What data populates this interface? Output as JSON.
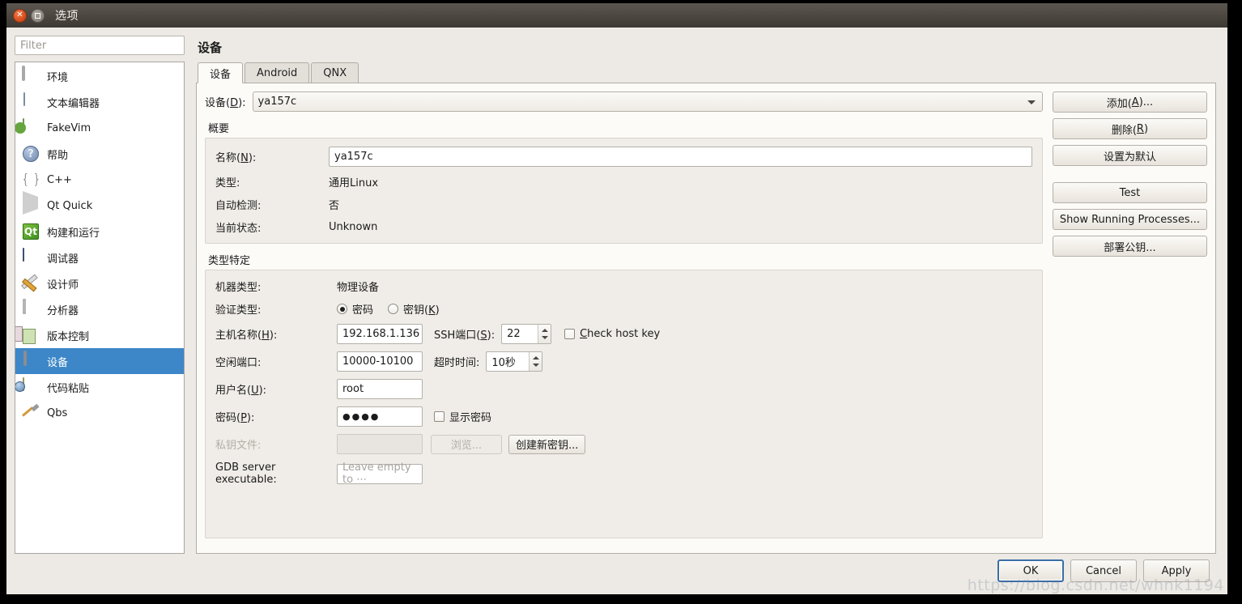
{
  "window": {
    "title": "选项",
    "close_icon": "close-icon",
    "maximize_icon": "maximize-icon"
  },
  "sidebar": {
    "filter_placeholder": "Filter",
    "items": [
      {
        "label": "环境",
        "icon": "monitor-icon",
        "selected": false
      },
      {
        "label": "文本编辑器",
        "icon": "text-editor-icon",
        "selected": false
      },
      {
        "label": "FakeVim",
        "icon": "fakevim-icon",
        "selected": false
      },
      {
        "label": "帮助",
        "icon": "help-icon",
        "selected": false
      },
      {
        "label": "C++",
        "icon": "braces-icon",
        "selected": false
      },
      {
        "label": "Qt Quick",
        "icon": "qtquick-icon",
        "selected": false
      },
      {
        "label": "构建和运行",
        "icon": "build-run-icon",
        "selected": false
      },
      {
        "label": "调试器",
        "icon": "debugger-bug-icon",
        "selected": false
      },
      {
        "label": "设计师",
        "icon": "designer-icon",
        "selected": false
      },
      {
        "label": "分析器",
        "icon": "analyzer-icon",
        "selected": false
      },
      {
        "label": "版本控制",
        "icon": "version-control-icon",
        "selected": false
      },
      {
        "label": "设备",
        "icon": "device-icon",
        "selected": true
      },
      {
        "label": "代码粘贴",
        "icon": "code-paste-icon",
        "selected": false
      },
      {
        "label": "Qbs",
        "icon": "qbs-hammer-icon",
        "selected": false
      }
    ],
    "selected_color": "#3d87c8"
  },
  "page": {
    "title": "设备",
    "tabs": [
      {
        "label": "设备",
        "active": true
      },
      {
        "label": "Android",
        "active": false
      },
      {
        "label": "QNX",
        "active": false
      }
    ]
  },
  "device_select": {
    "label_pre": "设备(",
    "label_mnemonic": "D",
    "label_post": "):",
    "value": "ya157c",
    "arrow_icon": "chevron-down-icon"
  },
  "summary": {
    "title": "概要",
    "name_label_pre": "名称(",
    "name_label_mnemonic": "N",
    "name_label_post": "):",
    "name_value": "ya157c",
    "rows": [
      {
        "label": "类型:",
        "value": "通用Linux"
      },
      {
        "label": "自动检测:",
        "value": "否"
      },
      {
        "label": "当前状态:",
        "value": "Unknown"
      }
    ]
  },
  "type_specific": {
    "title": "类型特定",
    "machine_type_label": "机器类型:",
    "machine_type_value": "物理设备",
    "auth_type_label": "验证类型:",
    "auth_password_label": "密码",
    "auth_key_label_pre": "密钥(",
    "auth_key_mnemonic": "K",
    "auth_key_label_post": ")",
    "auth_selected": "password",
    "host_label_pre": "主机名称(",
    "host_mnemonic": "H",
    "host_label_post": "):",
    "host_value": "192.168.1.136",
    "ssh_port_label_pre": "SSH端口(",
    "ssh_port_mnemonic": "S",
    "ssh_port_label_post": "):",
    "ssh_port_value": "22",
    "check_host_key_label_pre": "",
    "check_host_key_mnemonic": "C",
    "check_host_key_label_post": "heck host key",
    "check_host_key_checked": false,
    "free_ports_label": "空闲端口:",
    "free_ports_value": "10000-10100",
    "timeout_label": "超时时间:",
    "timeout_value": "10秒",
    "username_label_pre": "用户名(",
    "username_mnemonic": "U",
    "username_label_post": "):",
    "username_value": "root",
    "password_label_pre": "密码(",
    "password_mnemonic": "P",
    "password_label_post": "):",
    "password_value": "●●●●",
    "show_password_label": "显示密码",
    "show_password_checked": false,
    "private_key_label": "私钥文件:",
    "private_key_value": "",
    "browse_label": "浏览...",
    "create_key_label": "创建新密钥...",
    "gdb_label": "GDB server executable:",
    "gdb_placeholder": "Leave empty to ⋯"
  },
  "side_buttons": [
    {
      "label_pre": "添加(",
      "mnemonic": "A",
      "label_post": ")...",
      "name": "add"
    },
    {
      "label_pre": "删除(",
      "mnemonic": "R",
      "label_post": ")",
      "name": "remove"
    },
    {
      "label_pre": "设置为默认",
      "mnemonic": "",
      "label_post": "",
      "name": "set-default"
    },
    {
      "label_pre": "Test",
      "mnemonic": "",
      "label_post": "",
      "name": "test"
    },
    {
      "label_pre": "Show Running Processes...",
      "mnemonic": "",
      "label_post": "",
      "name": "show-running-processes"
    },
    {
      "label_pre": "部署公钥...",
      "mnemonic": "",
      "label_post": "",
      "name": "deploy-public-key"
    }
  ],
  "dialog_buttons": {
    "ok": "OK",
    "cancel": "Cancel",
    "apply": "Apply",
    "default": "ok",
    "focus_color": "#3a6ea5"
  },
  "watermark": "https://blog.csdn.net/whnk1194"
}
